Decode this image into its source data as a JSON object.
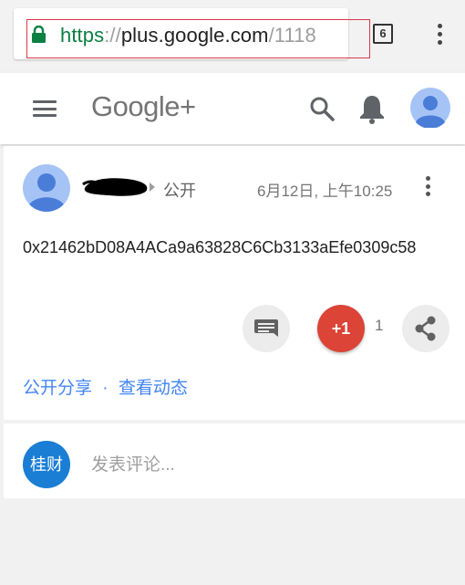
{
  "browser": {
    "url": {
      "scheme": "https",
      "separator": "://",
      "host": "plus.google.com",
      "path": "/1118"
    },
    "tab_count": "6",
    "icons": [
      "lock-icon",
      "tabs-icon",
      "more-vert-icon"
    ]
  },
  "header": {
    "logo": "Google+",
    "icons": [
      "menu-icon",
      "search-icon",
      "notifications-bell-icon",
      "account-avatar-icon"
    ]
  },
  "post": {
    "visibility": "公开",
    "timestamp": "6月12日, 上午10:25",
    "body": "0x21462bD08A4ACa9a63828C6Cb3133aEfe0309c58",
    "plus_one_label": "+1",
    "plus_one_count": "1",
    "share_text": "公开分享",
    "separator": "·",
    "activity_link": "查看动态"
  },
  "comment": {
    "user_initials": "桂财",
    "placeholder": "发表评论..."
  },
  "colors": {
    "https_green": "#0b8043",
    "plus_one_red": "#db4437",
    "link_blue": "#4285f4",
    "commenter_blue": "#1a7ed4",
    "avatar_blue": "#a6c3f6",
    "highlight_red": "#d9394a"
  }
}
